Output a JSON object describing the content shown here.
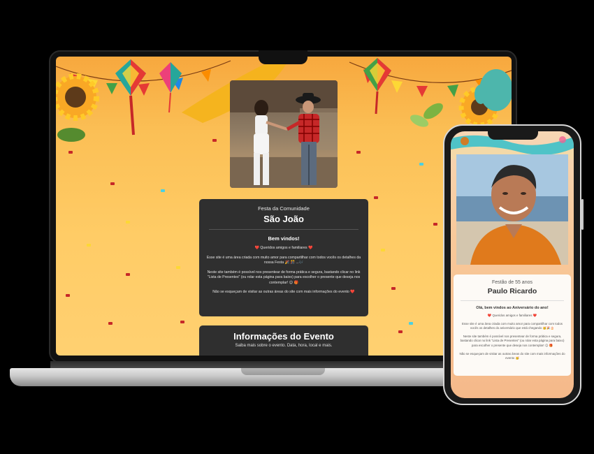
{
  "laptop": {
    "subtitle": "Festa da Comunidade",
    "title": "São João",
    "welcome": "Bem vindos!",
    "greeting": "❤️ Queridos amigos e familiares ❤️",
    "paragraph1": "Esse site é uma área criada com muito amor para compartilhar com todos vocês os detalhes da nossa Festa 🎉 🎊 ...🎶",
    "paragraph2": "Neste site também é possível nos presentear de forma prática e segura, bastando clicar no link \"Lista de Presentes\" (ou rolar esta página para baixo) para escolher o presente que deseja nos contemplar! 😉 🎁",
    "paragraph3": "Não se esqueçam de visitar as outras áreas do site com mais informações do evento ❤️",
    "info_title": "Informações do Evento",
    "info_sub": "Saiba mais sobre o evento. Data, hora, local e mais."
  },
  "phone": {
    "subtitle": "Festão de 55 anos",
    "title": "Paulo Ricardo",
    "welcome": "Olá, bem vindos ao Aniversário do ano!",
    "greeting": "❤️ Queridos amigos e familiares ❤️",
    "paragraph1": "Esse site é uma área criada com muito amor para compartilhar com todos vocês os detalhes do aniversário que está chegando 🥳🎉🎂",
    "paragraph2": "Neste site também é possível nos presentear de forma prática e segura, bastando clicar no link \"Lista de Presentes\" (ou rolar esta página para baixo) para escolher o presente que deseja nos contemplar! 😉 🎁",
    "paragraph3": "Não se esqueçam de visitar as outras áreas do site com mais informações do evento 🥳"
  },
  "colors": {
    "laptop_bg": "#ffcc66",
    "card_dark": "#2f2f2f",
    "phone_bg": "#f8c99a"
  }
}
